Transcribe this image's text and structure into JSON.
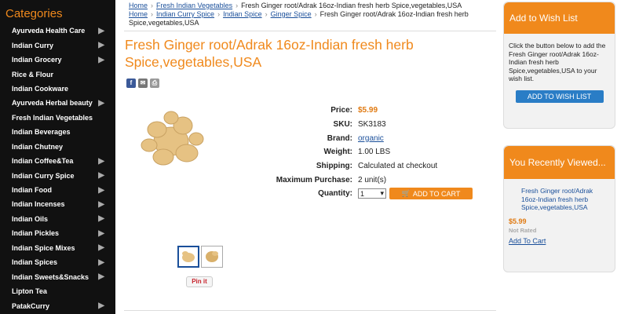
{
  "sidebar": {
    "title": "Categories",
    "items": [
      {
        "label": "Ayurveda Health Care",
        "has_arrow": true
      },
      {
        "label": "Indian Curry",
        "has_arrow": true
      },
      {
        "label": "Indian Grocery",
        "has_arrow": true
      },
      {
        "label": "Rice & Flour",
        "has_arrow": false
      },
      {
        "label": "Indian Cookware",
        "has_arrow": false
      },
      {
        "label": "Ayurveda Herbal beauty",
        "has_arrow": true
      },
      {
        "label": "Fresh Indian Vegetables",
        "has_arrow": false
      },
      {
        "label": "Indian Beverages",
        "has_arrow": false
      },
      {
        "label": "Indian Chutney",
        "has_arrow": false
      },
      {
        "label": "Indian Coffee&Tea",
        "has_arrow": true
      },
      {
        "label": "Indian Curry Spice",
        "has_arrow": true
      },
      {
        "label": "Indian Food",
        "has_arrow": true
      },
      {
        "label": "Indian Incenses",
        "has_arrow": true
      },
      {
        "label": "Indian Oils",
        "has_arrow": true
      },
      {
        "label": "Indian Pickles",
        "has_arrow": true
      },
      {
        "label": "Indian Spice Mixes",
        "has_arrow": true
      },
      {
        "label": "Indian Spices",
        "has_arrow": true
      },
      {
        "label": "Indian Sweets&Snacks",
        "has_arrow": true
      },
      {
        "label": "Lipton Tea",
        "has_arrow": false
      },
      {
        "label": "PatakCurry",
        "has_arrow": true
      }
    ]
  },
  "breadcrumbs": {
    "line1": [
      "Home",
      "Fresh Indian Vegetables"
    ],
    "line1_current": "Fresh Ginger root/Adrak 16oz-Indian fresh herb Spice,vegetables,USA",
    "line2": [
      "Home",
      "Indian Curry Spice",
      "Indian Spice",
      "Ginger Spice"
    ],
    "line2_current": "Fresh Ginger root/Adrak 16oz-Indian fresh herb Spice,vegetables,USA"
  },
  "product": {
    "title": "Fresh Ginger root/Adrak 16oz-Indian fresh herb Spice,vegetables,USA",
    "details": {
      "price_label": "Price:",
      "price": "$5.99",
      "sku_label": "SKU:",
      "sku": "SK3183",
      "brand_label": "Brand:",
      "brand": "organic",
      "weight_label": "Weight:",
      "weight": "1.00 LBS",
      "shipping_label": "Shipping:",
      "shipping": "Calculated at checkout",
      "max_label": "Maximum Purchase:",
      "max": "2 unit(s)",
      "qty_label": "Quantity:",
      "qty": "1"
    },
    "add_to_cart": "ADD TO CART",
    "pin_it": "Pin it"
  },
  "wishlist": {
    "title": "Add to Wish List",
    "text": "Click the button below to add the Fresh Ginger root/Adrak 16oz-Indian fresh herb Spice,vegetables,USA to your wish list.",
    "button": "ADD TO WISH LIST"
  },
  "recent": {
    "title": "You Recently Viewed...",
    "name": "Fresh Ginger root/Adrak 16oz-Indian fresh herb Spice,vegetables,USA",
    "price": "$5.99",
    "rating": "Not Rated",
    "add_to_cart": "Add To Cart"
  },
  "colors": {
    "accent": "#f0891c",
    "link": "#1a4f9a",
    "sidebar_bg": "#111111",
    "wish_button": "#2a7dc6"
  }
}
